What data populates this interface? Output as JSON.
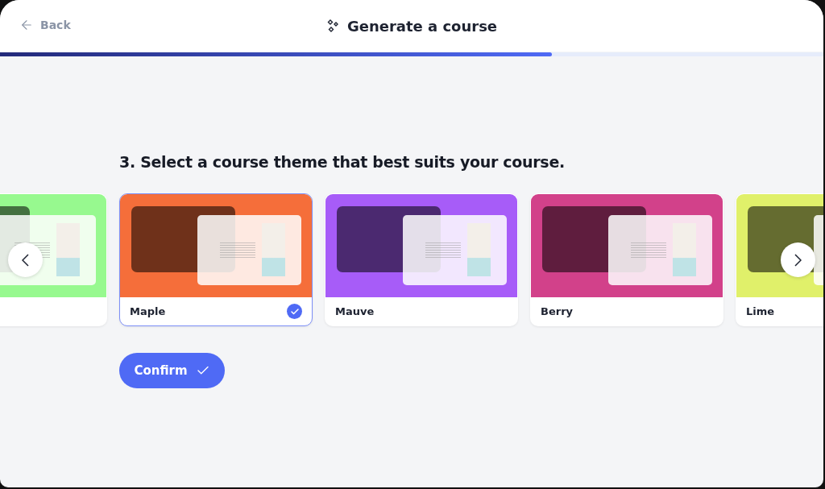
{
  "header": {
    "back": "Back",
    "title": "Generate a course"
  },
  "progress": {
    "level": 0.67
  },
  "question": "3. Select a course theme that best suits your course.",
  "themes": [
    {
      "color": "#97f98f",
      "selected": false
    },
    {
      "name": "Maple",
      "color": "#f56e3a",
      "selected": true
    },
    {
      "name": "Mauve",
      "color": "#a75cf8",
      "selected": false
    },
    {
      "name": "Berry",
      "color": "#d2418a",
      "selected": false
    },
    {
      "name": "Lime",
      "color": "#e0f06a",
      "selected": false
    }
  ],
  "confirm": "Confirm"
}
